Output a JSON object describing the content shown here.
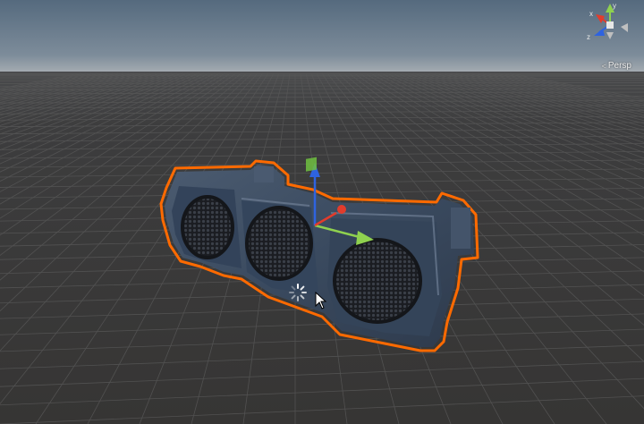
{
  "viewport": {
    "projection_label": "Persp",
    "projection_icon": "chevron-left-icon",
    "gizmo_axes": {
      "x_label": "x",
      "y_label": "y",
      "z_label": "z"
    },
    "colors": {
      "sky_top": "#5b6c80",
      "horizon": "#9aa1a8",
      "ground": "#3a3a3a",
      "grid": "#555555",
      "selection_outline": "#ff6a00",
      "axis_x": "#e23c2c",
      "axis_y": "#8fd14f",
      "axis_z": "#2e63e0",
      "model_body": "#3e4f66"
    }
  },
  "scene_object": {
    "name_icon": "traffic-light-model",
    "selected": true
  },
  "transform_handle": {
    "icons": [
      "move-y-arrow-icon",
      "move-z-arrow-icon",
      "move-x-arrow-icon",
      "plane-handle-icon"
    ]
  },
  "cursor": {
    "icon": "pointer-cursor-icon",
    "busy_icon": "loading-spinner-icon"
  }
}
